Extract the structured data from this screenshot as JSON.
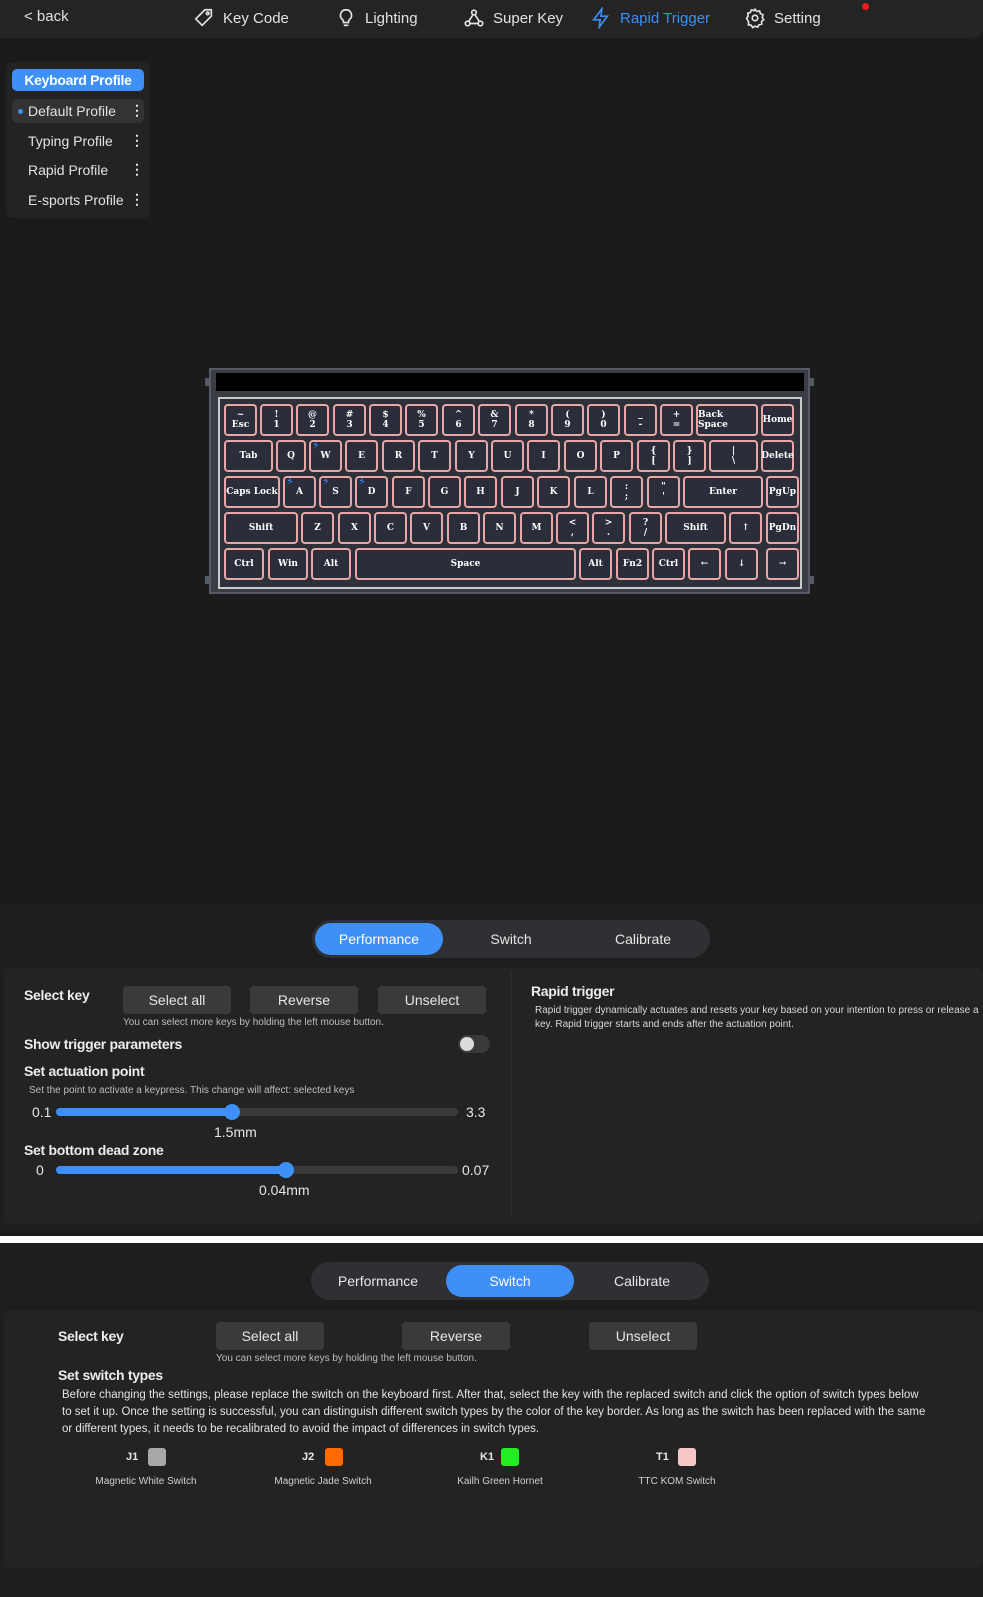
{
  "nav": {
    "back": "< back",
    "items": [
      {
        "label": "Key Code",
        "icon": "tag-icon"
      },
      {
        "label": "Lighting",
        "icon": "bulb-icon"
      },
      {
        "label": "Super Key",
        "icon": "nodes-icon"
      },
      {
        "label": "Rapid Trigger",
        "icon": "bolt-icon",
        "active": true
      },
      {
        "label": "Setting",
        "icon": "gear-icon"
      }
    ],
    "accent": "#3c8ef7"
  },
  "profiles": {
    "header": "Keyboard Profile",
    "items": [
      {
        "label": "Default Profile",
        "selected": true
      },
      {
        "label": "Typing Profile"
      },
      {
        "label": "Rapid Profile"
      },
      {
        "label": "E-sports Profile"
      }
    ]
  },
  "keyboard": {
    "rows": [
      [
        [
          "~",
          "Esc"
        ],
        [
          "!",
          "1"
        ],
        [
          "@",
          "2"
        ],
        [
          "#",
          "3"
        ],
        [
          "$",
          "4"
        ],
        [
          "%",
          "5"
        ],
        [
          "^",
          "6"
        ],
        [
          "&",
          "7"
        ],
        [
          "*",
          "8"
        ],
        [
          "(",
          "9"
        ],
        [
          ")",
          "0"
        ],
        [
          "_",
          "-"
        ],
        [
          "+",
          "="
        ],
        [
          "Back Space"
        ],
        [
          "Home"
        ]
      ],
      [
        [
          "Tab"
        ],
        [
          "Q"
        ],
        [
          "W"
        ],
        [
          "E"
        ],
        [
          "R"
        ],
        [
          "T"
        ],
        [
          "Y"
        ],
        [
          "U"
        ],
        [
          "I"
        ],
        [
          "O"
        ],
        [
          "P"
        ],
        [
          "{",
          "["
        ],
        [
          "}",
          "]"
        ],
        [
          "|",
          "\\"
        ],
        [
          "Delete"
        ]
      ],
      [
        [
          "Caps Lock"
        ],
        [
          "A"
        ],
        [
          "S"
        ],
        [
          "D"
        ],
        [
          "F"
        ],
        [
          "G"
        ],
        [
          "H"
        ],
        [
          "J"
        ],
        [
          "K"
        ],
        [
          "L"
        ],
        [
          ":",
          ";"
        ],
        [
          "\"",
          "'"
        ],
        [
          "Enter"
        ],
        [
          "PgUp"
        ]
      ],
      [
        [
          "Shift"
        ],
        [
          "Z"
        ],
        [
          "X"
        ],
        [
          "C"
        ],
        [
          "V"
        ],
        [
          "B"
        ],
        [
          "N"
        ],
        [
          "M"
        ],
        [
          "<",
          ","
        ],
        [
          ">",
          "."
        ],
        [
          "?",
          "/"
        ],
        [
          "Shift"
        ],
        [
          "↑"
        ],
        [
          "PgDn"
        ]
      ],
      [
        [
          "Ctrl"
        ],
        [
          "Win"
        ],
        [
          "Alt"
        ],
        [
          "Space"
        ],
        [
          "Alt"
        ],
        [
          "Fn2"
        ],
        [
          "Ctrl"
        ],
        [
          "←"
        ],
        [
          "↓"
        ],
        [
          "→"
        ]
      ]
    ],
    "rapid_keys": [
      "W",
      "A",
      "S",
      "D"
    ],
    "key_border_color": "#e8a6a6"
  },
  "performance": {
    "tabs": [
      "Performance",
      "Switch",
      "Calibrate"
    ],
    "active_tab": "Performance",
    "select_key_label": "Select key",
    "buttons": [
      "Select all",
      "Reverse",
      "Unselect"
    ],
    "hint": "You can select more keys by holding the left mouse button.",
    "show_trigger_label": "Show trigger parameters",
    "show_trigger_on": false,
    "actuation": {
      "title": "Set actuation point",
      "desc": "Set the point to activate a keypress. This change will affect: selected keys",
      "min": "0.1",
      "max": "3.3",
      "value": 1.5,
      "value_label": "1.5mm"
    },
    "deadzone": {
      "title": "Set bottom dead zone",
      "min": "0",
      "max": "0.07",
      "value": 0.04,
      "value_label": "0.04mm"
    },
    "rapid": {
      "title": "Rapid trigger",
      "desc_line1": "Rapid trigger dynamically actuates and resets your key based on your intention to press or release a",
      "desc_line2": "key. Rapid trigger starts and ends after the actuation point."
    }
  },
  "switch": {
    "tabs": [
      "Performance",
      "Switch",
      "Calibrate"
    ],
    "active_tab": "Switch",
    "select_key_label": "Select key",
    "buttons": [
      "Select all",
      "Reverse",
      "Unselect"
    ],
    "hint": "You can select more keys by holding the left mouse button.",
    "title": "Set switch types",
    "desc_lines": [
      "Before changing the settings, please replace the switch on the keyboard first. After that, select the key with the replaced switch and click the option of switch types below",
      "to set it up. Once the setting is successful, you can distinguish different switch types by the color of the key border. As long as the switch has been replaced with the same",
      "or different types, it needs to be recalibrated to avoid the impact of differences in switch types."
    ],
    "types": [
      {
        "code": "J1",
        "name": "Magnetic White Switch",
        "color": "#a8a8a8"
      },
      {
        "code": "J2",
        "name": "Magnetic Jade Switch",
        "color": "#ff6a00"
      },
      {
        "code": "K1",
        "name": "Kailh Green Hornet",
        "color": "#22ee22"
      },
      {
        "code": "T1",
        "name": "TTC KOM Switch",
        "color": "#f7c7c7"
      }
    ]
  }
}
